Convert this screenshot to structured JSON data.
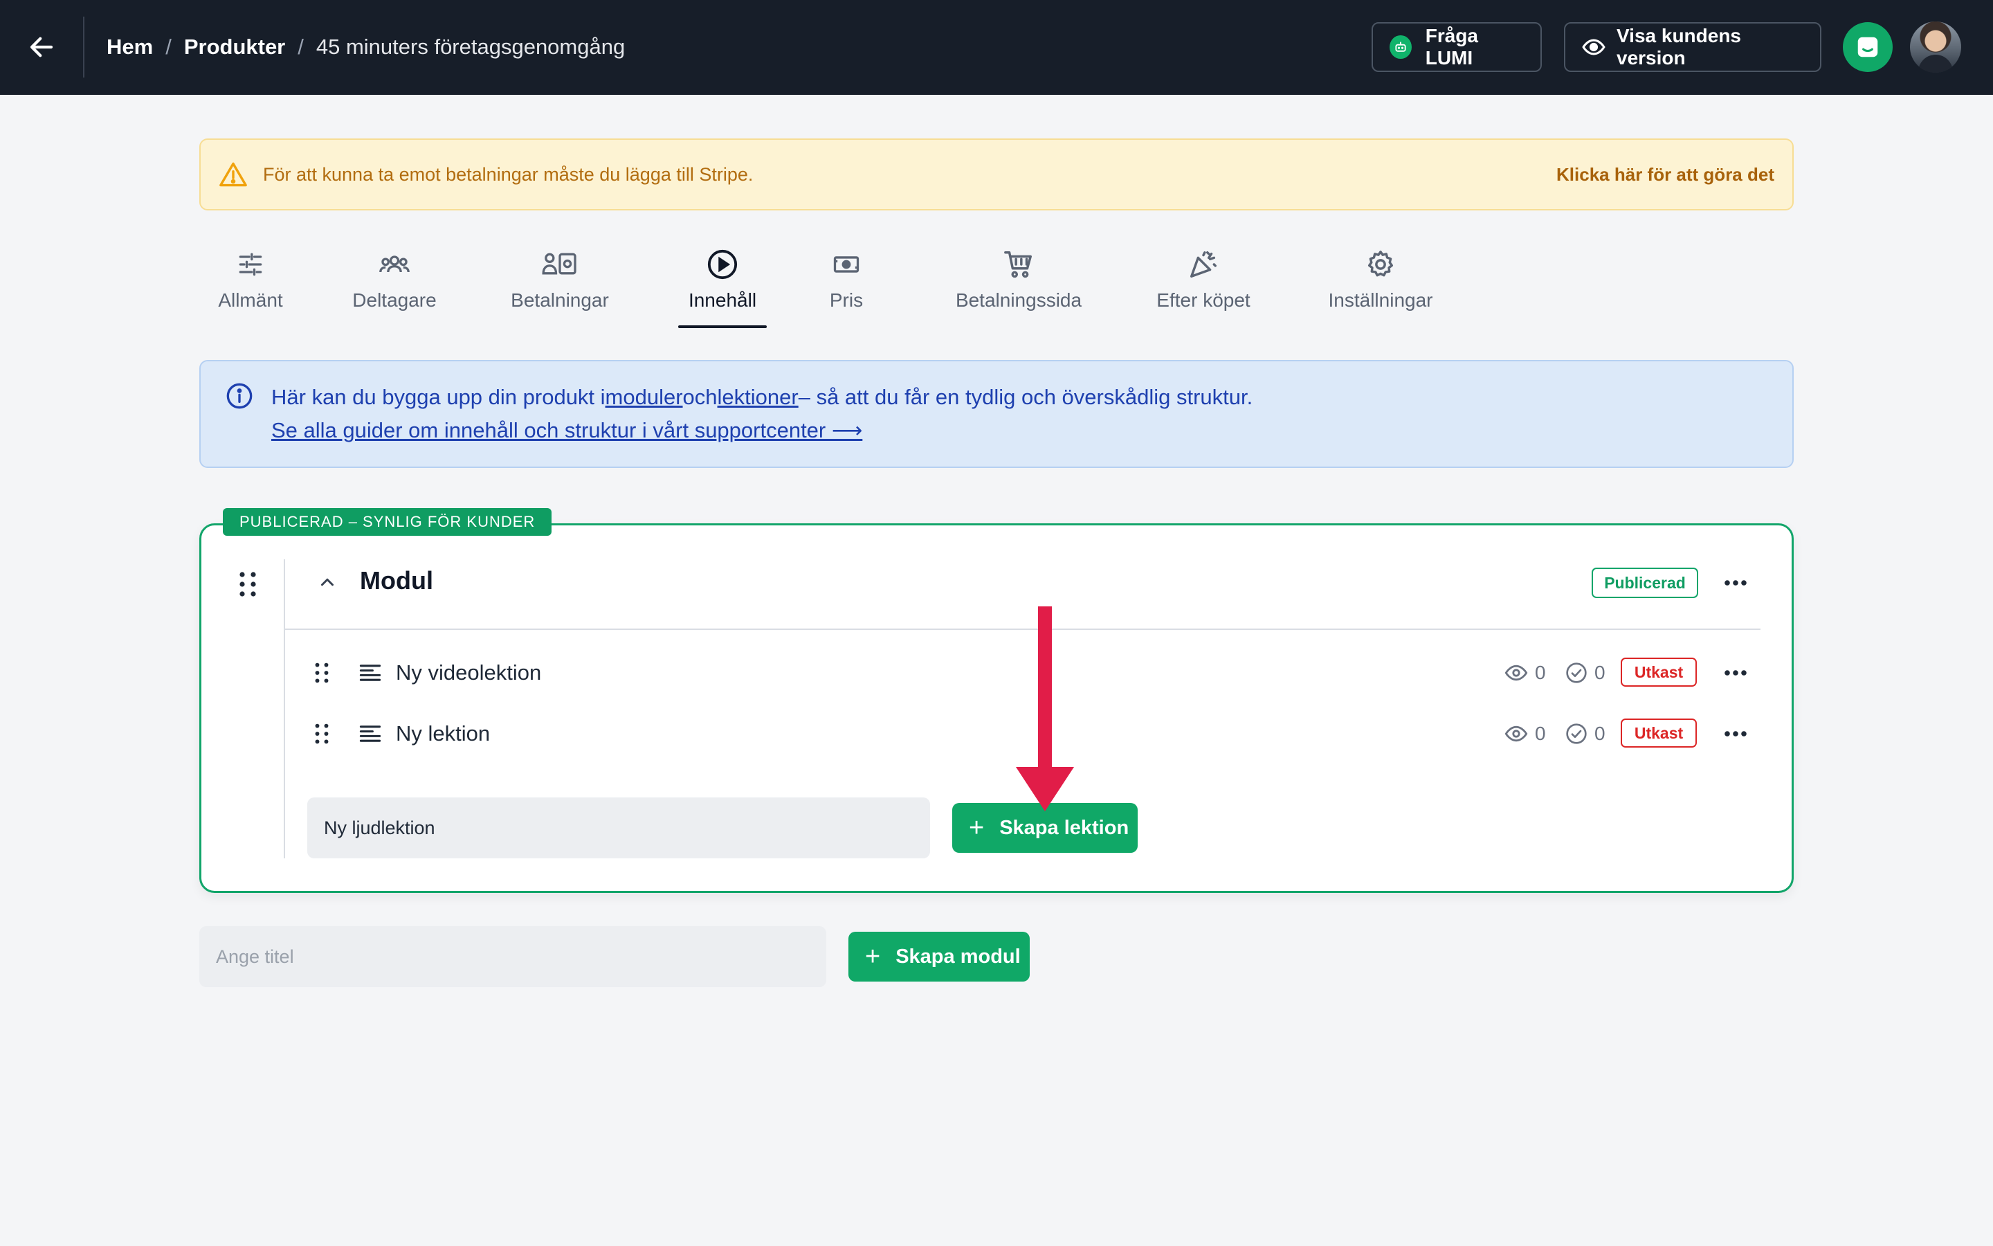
{
  "topbar": {
    "breadcrumb": [
      "Hem",
      "Produkter",
      "45 minuters företagsgenomgång"
    ],
    "ask_lumi_label": "Fråga LUMI",
    "customer_view_label": "Visa kundens version"
  },
  "warning": {
    "text": "För att kunna ta emot betalningar måste du lägga till Stripe.",
    "link": "Klicka här för att göra det"
  },
  "tabs": [
    {
      "label": "Allmänt",
      "icon": "sliders-icon"
    },
    {
      "label": "Deltagare",
      "icon": "people-icon"
    },
    {
      "label": "Betalningar",
      "icon": "payments-icon"
    },
    {
      "label": "Innehåll",
      "icon": "play-circle-icon",
      "active": true
    },
    {
      "label": "Pris",
      "icon": "banknote-icon"
    },
    {
      "label": "Betalningssida",
      "icon": "cart-icon"
    },
    {
      "label": "Efter köpet",
      "icon": "party-icon"
    },
    {
      "label": "Inställningar",
      "icon": "gear-icon"
    }
  ],
  "info": {
    "line1_prefix": "Här kan du bygga upp din produkt i",
    "line1_link1": "moduler",
    "line1_mid": "och",
    "line1_link2": "lektioner",
    "line1_suffix": "– så att du får en tydlig och överskådlig struktur.",
    "line2_link": "Se alla guider om innehåll och struktur i vårt supportcenter ⟶"
  },
  "module": {
    "status_pill": "PUBLICERAD – SYNLIG FÖR KUNDER",
    "title": "Modul",
    "badge": "Publicerad",
    "lessons": [
      {
        "title": "Ny videolektion",
        "views": "0",
        "completions": "0",
        "status": "Utkast"
      },
      {
        "title": "Ny lektion",
        "views": "0",
        "completions": "0",
        "status": "Utkast"
      }
    ],
    "new_lesson_value": "Ny ljudlektion",
    "create_lesson_label": "Skapa lektion"
  },
  "new_module": {
    "placeholder": "Ange titel",
    "create_module_label": "Skapa modul"
  },
  "colors": {
    "topbar": "#171e29",
    "accent_green": "#10a867",
    "draft_red": "#dc2626",
    "annotation_arrow": "#e11d48"
  }
}
